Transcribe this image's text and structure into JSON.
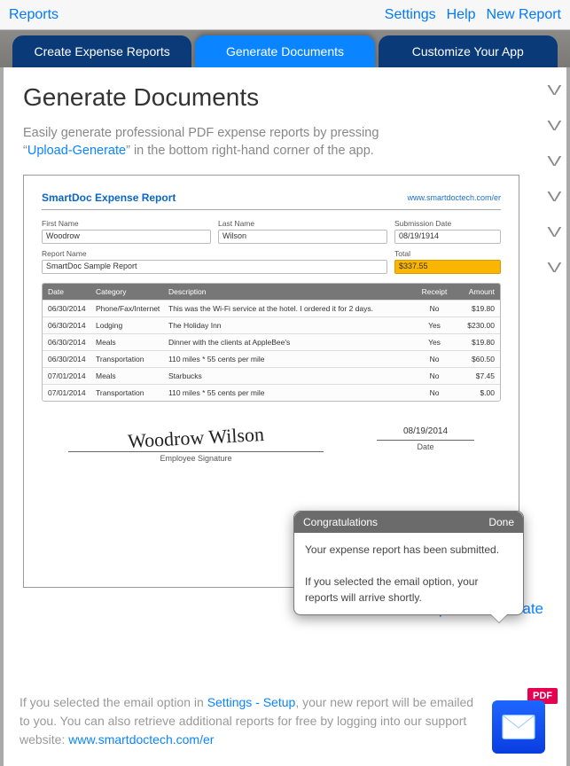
{
  "navbar": {
    "back": "Reports",
    "settings": "Settings",
    "help": "Help",
    "new_report": "New Report"
  },
  "tabs": {
    "create": "Create Expense Reports",
    "generate": "Generate Documents",
    "customize": "Customize Your App"
  },
  "page": {
    "title": "Generate Documents",
    "lead_pre": "Easily generate professional PDF expense reports by pressing “",
    "lead_link": "Upload-Generate",
    "lead_post": "” in the bottom right-hand corner of the app."
  },
  "report": {
    "title": "SmartDoc Expense Report",
    "url": "www.smartdoctech.com/er",
    "labels": {
      "first_name": "First Name",
      "last_name": "Last Name",
      "submission_date": "Submission Date",
      "report_name": "Report Name",
      "total": "Total",
      "emp_sig": "Employee Signature",
      "date": "Date"
    },
    "values": {
      "first_name": "Woodrow",
      "last_name": "Wilson",
      "submission_date": "08/19/1914",
      "report_name": "SmartDoc Sample Report",
      "total": "$337.55",
      "signature_script": "Woodrow Wilson",
      "sig_date": "08/19/2014"
    },
    "columns": {
      "date": "Date",
      "category": "Category",
      "description": "Description",
      "receipt": "Receipt",
      "amount": "Amount"
    },
    "rows": [
      {
        "date": "06/30/2014",
        "category": "Phone/Fax/Internet",
        "description": "This was the Wi-Fi service at the hotel. I ordered it for 2 days.",
        "receipt": "No",
        "amount": "$19.80"
      },
      {
        "date": "06/30/2014",
        "category": "Lodging",
        "description": "The Holiday Inn",
        "receipt": "Yes",
        "amount": "$230.00"
      },
      {
        "date": "06/30/2014",
        "category": "Meals",
        "description": "Dinner with the clients at AppleBee's",
        "receipt": "Yes",
        "amount": "$19.80"
      },
      {
        "date": "06/30/2014",
        "category": "Transportation",
        "description": "110 miles * 55 cents per mile",
        "receipt": "No",
        "amount": "$60.50"
      },
      {
        "date": "07/01/2014",
        "category": "Meals",
        "description": "Starbucks",
        "receipt": "No",
        "amount": "$7.45"
      },
      {
        "date": "07/01/2014",
        "category": "Transportation",
        "description": "110 miles * 55 cents per mile",
        "receipt": "No",
        "amount": "$.00"
      }
    ]
  },
  "popup": {
    "title": "Congratulations",
    "done": "Done",
    "body1": "Your expense report has been submitted.",
    "body2": "If you selected the email option, your reports will arrive shortly."
  },
  "upload_generate": "Upload-Generate",
  "footer": {
    "t1": "If you selected the email option in ",
    "link1": "Settings - Setup",
    "t2": ", your new report will be emailed to you. You can also retrieve additional reports for free by logging into our support website: ",
    "link2": "www.smartdoctech.com/er"
  },
  "pdf_badge": "PDF"
}
